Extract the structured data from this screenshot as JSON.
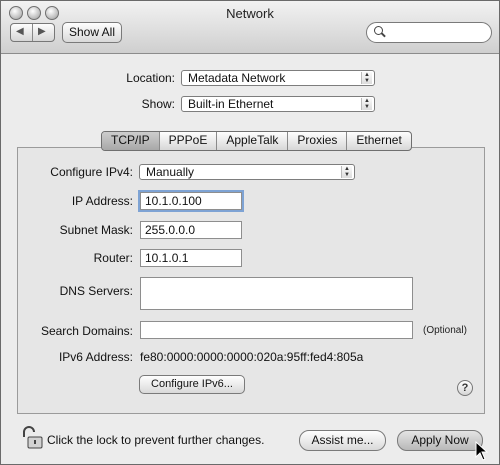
{
  "window": {
    "title": "Network"
  },
  "toolbar": {
    "back_icon": "arrow-left-icon",
    "forward_icon": "arrow-right-icon",
    "show_all_label": "Show All",
    "search_value": ""
  },
  "location": {
    "label": "Location:",
    "value": "Metadata Network"
  },
  "show": {
    "label": "Show:",
    "value": "Built-in Ethernet"
  },
  "tabs": [
    {
      "label": "TCP/IP",
      "active": true
    },
    {
      "label": "PPPoE",
      "active": false
    },
    {
      "label": "AppleTalk",
      "active": false
    },
    {
      "label": "Proxies",
      "active": false
    },
    {
      "label": "Ethernet",
      "active": false
    }
  ],
  "tcpip": {
    "configure_label": "Configure IPv4:",
    "configure_value": "Manually",
    "ip_label": "IP Address:",
    "ip_value": "10.1.0.100",
    "subnet_label": "Subnet Mask:",
    "subnet_value": "255.0.0.0",
    "router_label": "Router:",
    "router_value": "10.1.0.1",
    "dns_label": "DNS Servers:",
    "dns_value": "",
    "search_domains_label": "Search Domains:",
    "search_domains_value": "",
    "optional_label": "(Optional)",
    "ipv6_label": "IPv6 Address:",
    "ipv6_value": "fe80:0000:0000:0000:020a:95ff:fed4:805a",
    "configure_ipv6_button": "Configure IPv6..."
  },
  "footer": {
    "lock_text": "Click the lock to prevent further changes.",
    "assist_button": "Assist me...",
    "apply_button": "Apply Now"
  }
}
